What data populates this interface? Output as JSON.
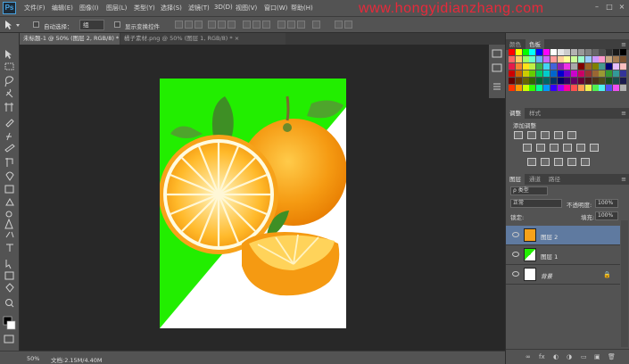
{
  "app": {
    "logo": "Ps",
    "menus": [
      "文件(F)",
      "编辑(E)",
      "图像(I)",
      "图层(L)",
      "类型(Y)",
      "选择(S)",
      "滤镜(T)",
      "3D(D)",
      "视图(V)",
      "窗口(W)",
      "帮助(H)"
    ],
    "watermark": "www.hongyidianzhang.com",
    "window_controls": [
      "–",
      "□",
      "×"
    ]
  },
  "options": {
    "auto_select_label": "自动选择：",
    "auto_select_value": "组",
    "show_transform_label": "显示变换控件"
  },
  "tabs": [
    {
      "label": "未标题-1 @ 50% (图层 2, RGB/8) *  ×"
    },
    {
      "label": "橘子素材.png @ 50% (图层 1, RGB/8) *  ×"
    }
  ],
  "status": {
    "zoom": "50%",
    "doc_info": "文档:2.15M/4.40M"
  },
  "panels": {
    "color_tabs": [
      "颜色",
      "色板"
    ],
    "adjust_tabs": [
      "调整",
      "样式"
    ],
    "adjust_title": "添加调整",
    "layers_tabs": [
      "图层",
      "通道",
      "路径"
    ],
    "filter_kind": "ρ 类型",
    "blend_mode": "正常",
    "opacity_label": "不透明度:",
    "opacity_value": "100%",
    "lock_label": "锁定:",
    "fill_label": "填充:",
    "fill_value": "100%",
    "layers": [
      {
        "name": "图层 2",
        "selected": true
      },
      {
        "name": "图层 1",
        "selected": false
      },
      {
        "name": "背景",
        "selected": false,
        "locked": true
      }
    ],
    "bottom_icons": [
      "∞",
      "fx",
      "◐",
      "◑",
      "▭",
      "▣",
      "🗑"
    ]
  },
  "colors": {
    "canvas_green": "#22ee00",
    "orange": "#f7a21a",
    "selected_layer": "#5f7aa0"
  }
}
